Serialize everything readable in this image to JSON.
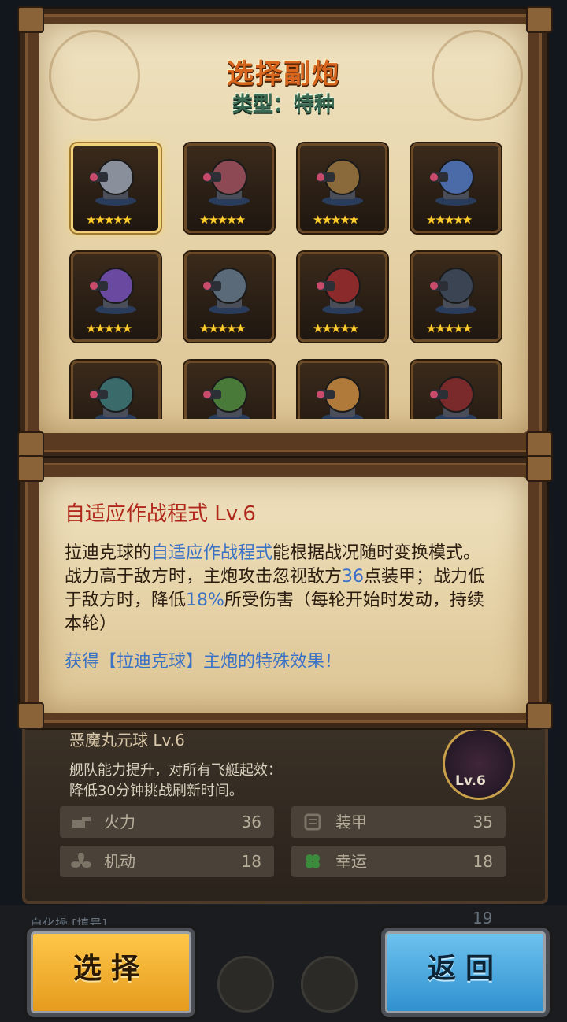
{
  "header": {
    "title": "选择副炮",
    "type_line": "类型：特种"
  },
  "turrets": [
    {
      "name": "turret-1",
      "stars": "★★★★★",
      "selected": true,
      "color": "#8a8f9c"
    },
    {
      "name": "turret-2",
      "stars": "★★★★★",
      "selected": false,
      "color": "#8d4a55"
    },
    {
      "name": "turret-3",
      "stars": "★★★★★",
      "selected": false,
      "color": "#8a6a3a"
    },
    {
      "name": "turret-4",
      "stars": "★★★★★",
      "selected": false,
      "color": "#4a6aa8"
    },
    {
      "name": "turret-5",
      "stars": "★★★★★",
      "selected": false,
      "color": "#6a4aa0"
    },
    {
      "name": "turret-6",
      "stars": "★★★★★",
      "selected": false,
      "color": "#5a6a78"
    },
    {
      "name": "turret-7",
      "stars": "★★★★★",
      "selected": false,
      "color": "#8a2a2a"
    },
    {
      "name": "turret-8",
      "stars": "★★★★★",
      "selected": false,
      "color": "#3a4452"
    },
    {
      "name": "turret-9",
      "stars": "",
      "selected": false,
      "color": "#3a6a6a"
    },
    {
      "name": "turret-10",
      "stars": "",
      "selected": false,
      "color": "#4a7a3a"
    },
    {
      "name": "turret-11",
      "stars": "",
      "selected": false,
      "color": "#b07a3a"
    },
    {
      "name": "turret-12",
      "stars": "",
      "selected": false,
      "color": "#7a2a2a"
    }
  ],
  "info": {
    "skill_title": "自适应作战程式 Lv.6",
    "desc_1": "拉迪克球的",
    "desc_hl_1": "自适应作战程式",
    "desc_2": "能根据战况随时变换模式。战力高于敌方时，主炮攻击忽视敌方",
    "desc_hl_2": "36",
    "desc_3": "点装甲；战力低于敌方时，降低",
    "desc_hl_3": "18%",
    "desc_4": "所受伤害（每轮开始时发动，持续本轮）",
    "gain": "获得【拉迪克球】主炮的特殊效果！"
  },
  "lower": {
    "title": "恶魔丸元球 Lv.6",
    "desc_line1": "舰队能力提升，对所有飞艇起效：",
    "desc_line2": "降低30分钟挑战刷新时间。",
    "level": "Lv.6",
    "stats": [
      {
        "label": "火力",
        "value": "36"
      },
      {
        "label": "装甲",
        "value": "35"
      },
      {
        "label": "机动",
        "value": "18"
      },
      {
        "label": "幸运",
        "value": "18"
      }
    ]
  },
  "bottom": {
    "behind_label": "自化操 [填号]",
    "behind_count": "19",
    "select_label": "选择",
    "back_label": "返回"
  },
  "colors": {
    "accent_title": "#d9661e",
    "highlight_blue": "#3b72c4",
    "skill_red": "#b0281c",
    "star": "#ffcf2e"
  }
}
